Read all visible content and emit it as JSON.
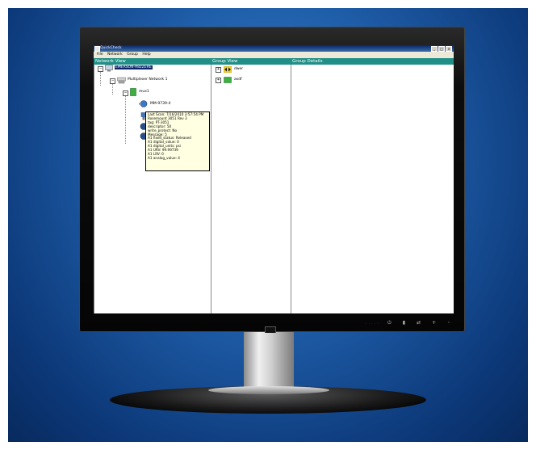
{
  "app": {
    "title": "QuickCheck",
    "window_buttons": [
      "_",
      "□",
      "×"
    ],
    "menu": [
      "File",
      "Network",
      "Group",
      "Help"
    ]
  },
  "network_view": {
    "header": "Network View",
    "tree": {
      "root": "EMERSON-A82ZERE",
      "network": "Multiplexer Network 1",
      "mux": "mux1",
      "device1": "MM-9739-4",
      "device2": "R-3051-3"
    }
  },
  "tooltip": {
    "lines": [
      "Last Scan: 7/16/2010 3:57:54 PM",
      "Rosemount 3051 Rev 3",
      "tag: PT-3051",
      "descriptor: 50",
      "write_protect: No",
      "Message: 5",
      "A1 fixed_status: Released",
      "A1 digital_value: 0",
      "A1 digital_units: psi",
      "A1 URV: 99.99739",
      "A1 LRV: 0",
      "A1 analog_value: 4"
    ]
  },
  "group_view": {
    "header": "Group View",
    "items": [
      "dwer",
      "asdf"
    ]
  },
  "group_details": {
    "header": "Group Details"
  },
  "colors": {
    "pane_header": "#1f8f87",
    "titlebar": "#0a246a",
    "selection": "#0a246a",
    "backdrop": "#1f5ea9"
  }
}
